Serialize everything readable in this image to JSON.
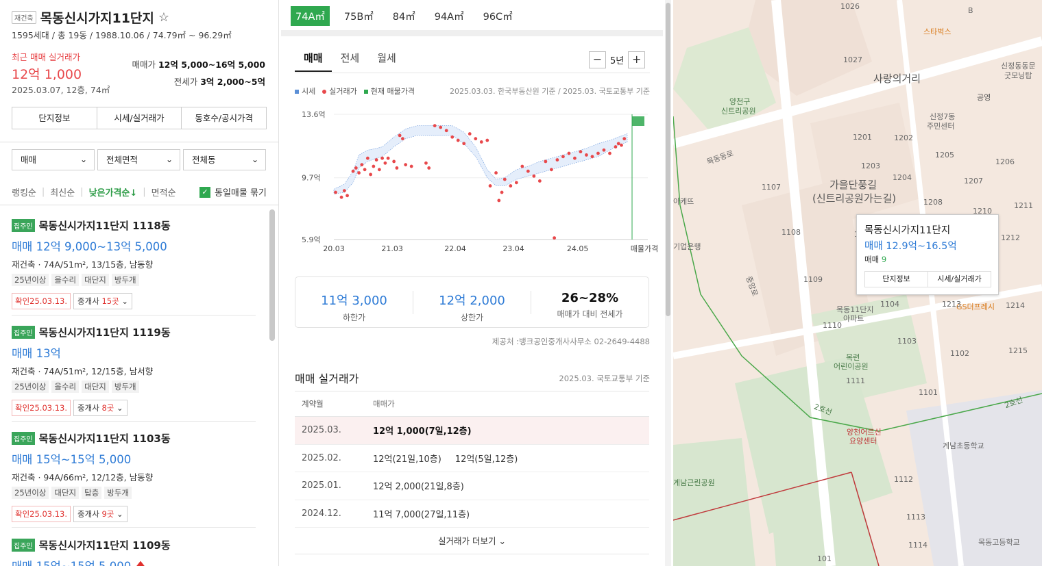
{
  "complex": {
    "badge": "재건축",
    "name": "목동신시가지11단지",
    "star": "☆",
    "summary": "1595세대 / 총 19동 / 1988.10.06 / 74.79㎡ ~ 96.29㎡",
    "recent_label": "최근 매매 실거래가",
    "recent_price": "12억 1,000",
    "recent_date": "2025.03.07, 12층, 74㎡",
    "sale_label": "매매가",
    "sale_range": "12억 5,000~16억 5,000",
    "jeonse_label": "전세가",
    "jeonse_range": "3억 2,000~5억"
  },
  "info_tabs": [
    "단지정보",
    "시세/실거래가",
    "동호수/공시가격"
  ],
  "filters": {
    "deal_type": "매매",
    "area": "전체면적",
    "dong": "전체동"
  },
  "sorts": {
    "items": [
      "랭킹순",
      "최신순",
      "낮은가격순",
      "면적순"
    ],
    "active_suffix": "↓",
    "group_label": "동일매물 묶기",
    "check": "✓"
  },
  "listings": [
    {
      "badge": "집주인",
      "name": "목동신시가지11단지 1118동",
      "price": "매매 12억 9,000~13억 5,000",
      "desc": "재건축 · 74A/51m², 13/15층, 남동향",
      "tags": [
        "25년이상",
        "올수리",
        "대단지",
        "방두개"
      ],
      "verified": "확인25.03.13.",
      "agents_label": "중개사",
      "agents_count": "15곳"
    },
    {
      "badge": "집주인",
      "name": "목동신시가지11단지 1119동",
      "price": "매매 13억",
      "desc": "재건축 · 74A/51m², 12/15층, 남서향",
      "tags": [
        "25년이상",
        "올수리",
        "대단지",
        "방두개"
      ],
      "verified": "확인25.03.13.",
      "agents_label": "중개사",
      "agents_count": "8곳"
    },
    {
      "badge": "집주인",
      "name": "목동신시가지11단지 1103동",
      "price": "매매 15억~15억 5,000",
      "desc": "재건축 · 94A/66m², 12/12층, 남동향",
      "tags": [
        "25년이상",
        "대단지",
        "탑층",
        "방두개"
      ],
      "verified": "확인25.03.13.",
      "agents_label": "중개사",
      "agents_count": "9곳"
    },
    {
      "badge": "집주인",
      "name": "목동신시가지11단지 1109동",
      "price": "매매 15억~15억 5,000"
    }
  ],
  "size_tabs": [
    "74A㎡",
    "75B㎡",
    "84㎡",
    "94A㎡",
    "96C㎡"
  ],
  "deal_tabs": [
    "매매",
    "전세",
    "월세"
  ],
  "period": {
    "minus": "−",
    "label": "5년",
    "plus": "+"
  },
  "legend": {
    "price": "시세",
    "actual": "실거래가",
    "current": "현재 매물가격",
    "basis": "2025.03.03. 한국부동산원 기준 / 2025.03. 국토교통부 기준"
  },
  "colors": {
    "accent": "#2fa84f",
    "actual_dot": "#e8484b",
    "band": "#5b8fd6",
    "link_blue": "#2e7bd6"
  },
  "chart_data": {
    "type": "scatter",
    "y_ticks": [
      "13.6억",
      "9.7억",
      "5.9억"
    ],
    "x_ticks": [
      "20.03",
      "21.03",
      "22.04",
      "23.04",
      "24.05",
      "매물가격"
    ],
    "ylim": [
      5.9,
      13.6
    ],
    "x_range": [
      2020.17,
      2025.2
    ],
    "band": {
      "x": [
        2020.17,
        2020.35,
        2020.5,
        2020.6,
        2020.75,
        2020.9,
        2021.0,
        2021.2,
        2021.4,
        2021.6,
        2021.8,
        2022.0,
        2022.2,
        2022.4,
        2022.6,
        2022.8,
        2022.95,
        2023.1,
        2023.3,
        2023.5,
        2023.7,
        2023.9,
        2024.1,
        2024.3,
        2024.5,
        2024.7,
        2024.9,
        2025.05,
        2025.2
      ],
      "low": [
        8.7,
        8.8,
        9.4,
        10.3,
        10.7,
        10.9,
        11.0,
        11.6,
        12.1,
        12.3,
        12.3,
        12.3,
        12.3,
        11.8,
        11.0,
        9.7,
        9.2,
        9.2,
        9.6,
        9.8,
        10.0,
        10.2,
        10.4,
        10.6,
        10.8,
        11.0,
        11.4,
        11.7,
        11.9
      ],
      "high": [
        9.0,
        9.3,
        10.1,
        11.1,
        11.4,
        11.5,
        11.6,
        12.2,
        12.7,
        12.9,
        12.9,
        12.9,
        12.9,
        12.5,
        11.6,
        10.2,
        9.6,
        9.7,
        10.2,
        10.4,
        10.7,
        10.9,
        11.1,
        11.3,
        11.5,
        11.8,
        12.0,
        12.2,
        12.4
      ]
    },
    "actual": [
      [
        2020.2,
        8.8
      ],
      [
        2020.3,
        8.5
      ],
      [
        2020.35,
        8.9
      ],
      [
        2020.4,
        8.6
      ],
      [
        2020.5,
        10.1
      ],
      [
        2020.55,
        10.3
      ],
      [
        2020.6,
        10.0
      ],
      [
        2020.65,
        10.5
      ],
      [
        2020.7,
        10.2
      ],
      [
        2020.75,
        10.9
      ],
      [
        2020.8,
        9.9
      ],
      [
        2020.85,
        10.4
      ],
      [
        2020.9,
        10.8
      ],
      [
        2020.95,
        10.2
      ],
      [
        2021.0,
        10.9
      ],
      [
        2021.05,
        10.6
      ],
      [
        2021.1,
        10.9
      ],
      [
        2021.2,
        10.7
      ],
      [
        2021.25,
        10.3
      ],
      [
        2021.3,
        12.3
      ],
      [
        2021.35,
        12.1
      ],
      [
        2021.4,
        10.5
      ],
      [
        2021.5,
        10.4
      ],
      [
        2021.75,
        10.6
      ],
      [
        2021.8,
        10.3
      ],
      [
        2021.9,
        12.9
      ],
      [
        2022.0,
        12.8
      ],
      [
        2022.1,
        12.6
      ],
      [
        2022.2,
        12.2
      ],
      [
        2022.3,
        12.0
      ],
      [
        2022.4,
        11.8
      ],
      [
        2022.5,
        12.4
      ],
      [
        2022.6,
        12.1
      ],
      [
        2022.7,
        11.9
      ],
      [
        2022.8,
        12.0
      ],
      [
        2022.85,
        9.2
      ],
      [
        2022.95,
        10.0
      ],
      [
        2023.0,
        8.3
      ],
      [
        2023.05,
        8.8
      ],
      [
        2023.1,
        9.6
      ],
      [
        2023.2,
        9.2
      ],
      [
        2023.3,
        9.4
      ],
      [
        2023.4,
        10.4
      ],
      [
        2023.5,
        10.1
      ],
      [
        2023.6,
        9.8
      ],
      [
        2023.7,
        9.5
      ],
      [
        2023.8,
        10.7
      ],
      [
        2023.9,
        10.2
      ],
      [
        2023.95,
        6.0
      ],
      [
        2024.0,
        10.8
      ],
      [
        2024.1,
        11.0
      ],
      [
        2024.2,
        11.2
      ],
      [
        2024.3,
        10.9
      ],
      [
        2024.4,
        11.3
      ],
      [
        2024.5,
        11.1
      ],
      [
        2024.6,
        11.0
      ],
      [
        2024.7,
        11.2
      ],
      [
        2024.8,
        11.4
      ],
      [
        2024.9,
        11.2
      ],
      [
        2025.0,
        11.6
      ],
      [
        2025.05,
        11.8
      ],
      [
        2025.1,
        11.7
      ],
      [
        2025.15,
        12.1
      ]
    ],
    "current": {
      "low": 12.9,
      "high": 16.5
    }
  },
  "summary_box": {
    "low_value": "11억 3,000",
    "low_label": "하한가",
    "high_value": "12억 2,000",
    "high_label": "상한가",
    "ratio_value": "26~28%",
    "ratio_label": "매매가 대비 전세가"
  },
  "provider": "제공처 :뱅크공인중개사사무소 02-2649-4488",
  "actual_table": {
    "title": "매매 실거래가",
    "basis": "2025.03. 국토교통부 기준",
    "col_month": "계약월",
    "col_price": "매매가",
    "rows": [
      {
        "month": "2025.03.",
        "deals": [
          "12억 1,000(7일,12층)"
        ]
      },
      {
        "month": "2025.02.",
        "deals": [
          "12억(21일,10층)",
          "12억(5일,12층)"
        ]
      },
      {
        "month": "2025.01.",
        "deals": [
          "12억 2,000(21일,8층)"
        ]
      },
      {
        "month": "2024.12.",
        "deals": [
          "11억 7,000(27일,11층)"
        ]
      }
    ],
    "more": "실거래가 더보기"
  },
  "map": {
    "popup": {
      "name": "목동신시가지11단지",
      "price": "매매 12.9억~16.5억",
      "count_label": "매매",
      "count": "9",
      "btn_info": "단지정보",
      "btn_price": "시세/실거래가"
    },
    "labels": {
      "starbucks": "스타벅스",
      "sarang": "사랑의거리",
      "sinjeong": "신정동동문",
      "goodmorning": "굿모닝탑",
      "gongyeong": "공영",
      "yangcheon_park1": "양천구",
      "yangcheon_park2": "신트리공원",
      "shinjeong7_1": "신정7동",
      "shinjeong7_2": "주민센터",
      "gaeul1": "가을단풍길",
      "gaeul2": "(신트리공원가는길)",
      "ibk": "기업은행",
      "apt11_1": "목동11단지",
      "apt11_2": "아파트",
      "gs": "GS더프레시",
      "mokryeon1": "목련",
      "mokryeon2": "어린이공원",
      "yangcheon_care1": "양천어르신",
      "yangcheon_care2": "요양센터",
      "gyenam_school": "계남초등학교",
      "gyenam_park": "계남근린공원",
      "mokdong_high": "목동고등학교",
      "mokdong_road": "목동동로",
      "jungang_road": "중앙로",
      "line2_a": "2호선",
      "line2_b": "2호선",
      "arcade": "아케뜨",
      "nums": [
        "1026",
        "B",
        "1027",
        "1201",
        "1202",
        "1203",
        "1204",
        "1205",
        "1206",
        "1207",
        "1107",
        "1208",
        "1210",
        "1211",
        "1108",
        "1106",
        "1212",
        "1109",
        "1104",
        "1110",
        "1213",
        "1214",
        "1103",
        "1102",
        "1215",
        "1111",
        "1101",
        "1112",
        "1113",
        "1114",
        "101"
      ]
    }
  }
}
